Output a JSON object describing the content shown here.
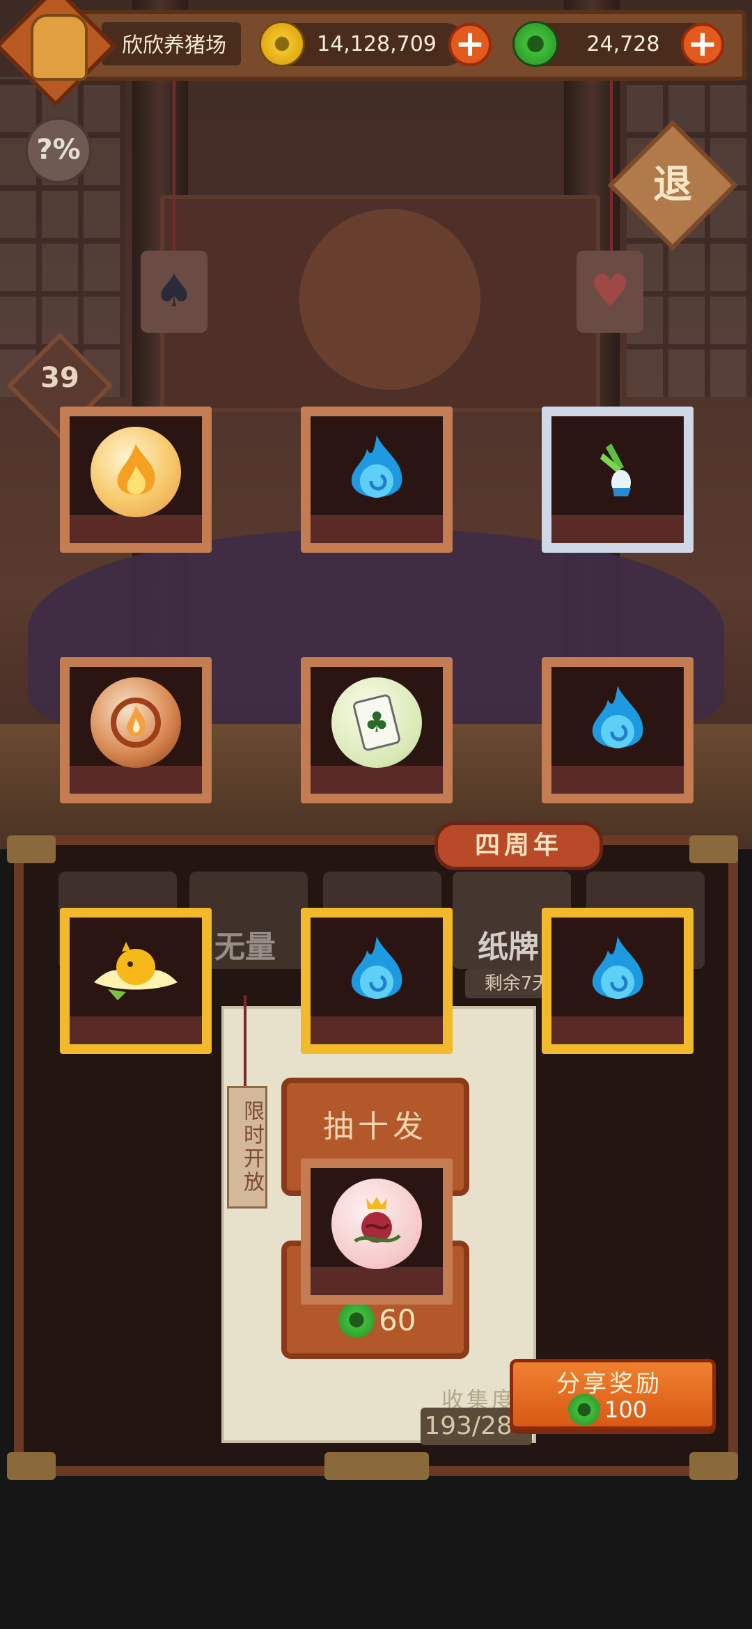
{
  "header": {
    "player_name": "欣欣养猪场",
    "gold_amount": "14,128,709",
    "jade_amount": "24,728",
    "add_gold_label": "+",
    "add_jade_label": "+"
  },
  "side": {
    "odds_label": "?%",
    "level": "39",
    "exit_label": "退"
  },
  "cards": [
    {
      "name": "fire-spirit-orb",
      "frame": "bronze",
      "item": "fire orb"
    },
    {
      "name": "blue-soul-flame",
      "frame": "bronze",
      "item": "blue flame"
    },
    {
      "name": "scallion-figure",
      "frame": "silver",
      "item": "scallion"
    },
    {
      "name": "flame-core-orb",
      "frame": "bronze",
      "item": "flame core orb"
    },
    {
      "name": "clover-card-orb",
      "frame": "bronze",
      "item": "clover card orb"
    },
    {
      "name": "blue-soul-flame",
      "frame": "bronze",
      "item": "blue flame"
    },
    {
      "name": "golden-lotus-bird",
      "frame": "gold",
      "item": "golden lotus"
    },
    {
      "name": "blue-soul-flame",
      "frame": "gold",
      "item": "blue flame"
    },
    {
      "name": "blue-soul-flame",
      "frame": "gold",
      "item": "blue flame"
    },
    {
      "name": "thorn-rose-orb",
      "frame": "bronze",
      "item": "rose orb"
    }
  ],
  "event": {
    "anniversary_label": "四周年",
    "tab_wuliang": "无量",
    "tab_cards": "纸牌",
    "days_left": "剩余7天",
    "limited_time": "限时开放"
  },
  "draw": {
    "draw_ten_label": "抽十发",
    "draw_cost": "60",
    "collection_label": "收集度",
    "collection_count": "193/282"
  },
  "share": {
    "label": "分享奖励",
    "amount": "100"
  },
  "colors": {
    "gold_coin": "#f2c52a",
    "jade_coin": "#3fbf3a",
    "plus_button": "#e25a1c",
    "frame_bronze": "#c47c52",
    "frame_silver": "#cfd8e6",
    "frame_gold": "#f2b92a"
  }
}
